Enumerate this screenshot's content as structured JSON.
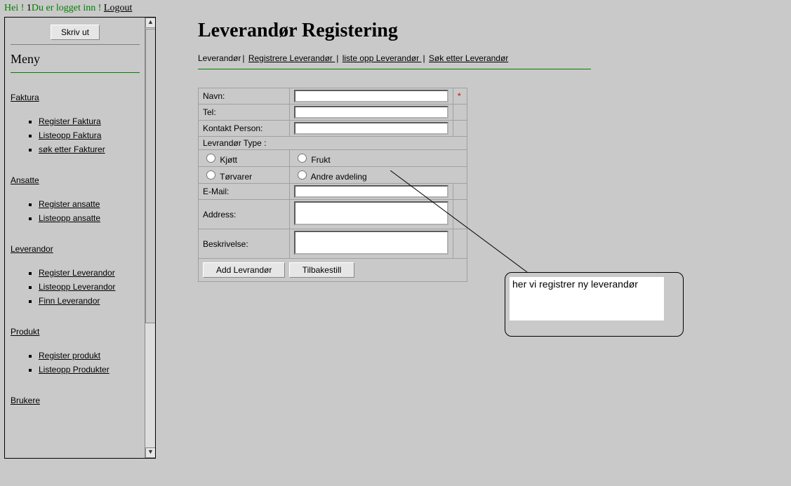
{
  "topbar": {
    "hei": "Hei ! ",
    "one": "1",
    "logged": "Du er logget inn ! ",
    "logout": "Logout"
  },
  "sidebar": {
    "print": "Skriv ut",
    "menu": "Meny",
    "sections": {
      "faktura": {
        "title": "Faktura",
        "items": [
          "Register Faktura",
          "Listeopp Faktura",
          "søk etter Fakturer"
        ]
      },
      "ansatte": {
        "title": "Ansatte",
        "items": [
          "Register ansatte",
          "Listeopp ansatte"
        ]
      },
      "leverandor": {
        "title": "Leverandor",
        "items": [
          "Register Leverandor",
          "Listeopp Leverandor",
          "Finn Leverandor"
        ]
      },
      "produkt": {
        "title": "Produkt",
        "items": [
          "Register produkt",
          "Listeopp Produkter"
        ]
      },
      "brukere": {
        "title": "Brukere"
      }
    }
  },
  "main": {
    "title": "Leverandør Registering",
    "crumbs": {
      "current": "Leverandør",
      "reg": "Registrere Leverandør ",
      "list": "liste opp Leverandør ",
      "search": "Søk etter Leverandør"
    },
    "form": {
      "navn": "Navn:",
      "tel": "Tel:",
      "kontakt": "Kontakt Person:",
      "type": "Levrandør Type :",
      "kjott": "Kjøtt",
      "torvarer": "Tørvarer",
      "frukt": "Frukt",
      "andre": "Andre avdeling",
      "email": "E-Mail:",
      "address": "Address:",
      "beskrivelse": "Beskrivelse:",
      "add": "Add Levrandør",
      "reset": "Tilbakestill",
      "required": "*"
    }
  },
  "callout": {
    "text": "her vi registrer ny leverandør"
  }
}
